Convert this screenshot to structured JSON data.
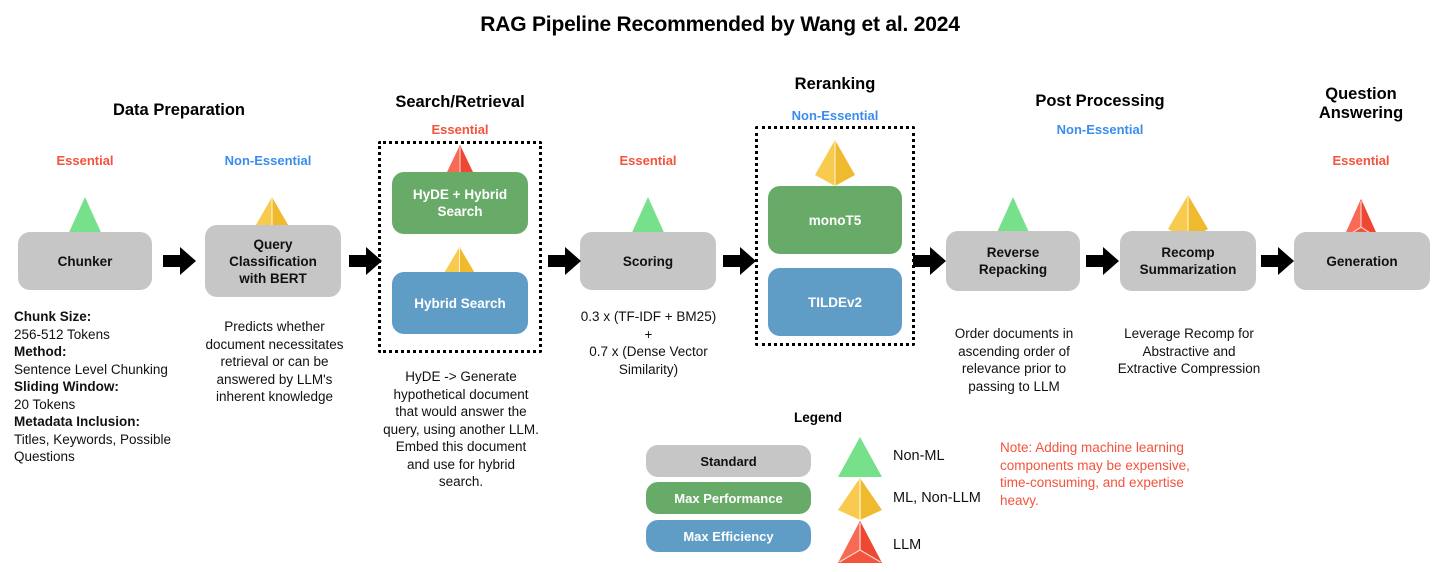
{
  "title": "RAG Pipeline Recommended by Wang et al. 2024",
  "colors": {
    "essential": "#f4533c",
    "non_essential": "#3b8ced",
    "standard_box": "#c6c6c6",
    "max_performance_box": "#68ab68",
    "max_efficiency_box": "#5f9dc7",
    "non_ml_triangle": "#77e08b",
    "ml_non_llm_triangle": "#f5c13b",
    "llm_triangle": "#f4533c",
    "arrow": "#000000",
    "note_text": "#f4533c"
  },
  "stages": [
    {
      "id": "data-preparation",
      "title": "Data Preparation",
      "nodes": [
        {
          "id": "chunker",
          "label": "Chunker",
          "style": "standard",
          "marker": "non-ml",
          "essentiality": "Essential",
          "essentiality_kind": "essential"
        },
        {
          "id": "query-classification",
          "label": "Query Classification with BERT",
          "style": "standard",
          "marker": "ml-non-llm",
          "essentiality": "Non-Essential",
          "essentiality_kind": "non-essential"
        }
      ]
    },
    {
      "id": "search-retrieval",
      "title": "Search/Retrieval",
      "essentiality": "Essential",
      "essentiality_kind": "essential",
      "group": [
        {
          "id": "hyde-hybrid-search",
          "label": "HyDE + Hybrid Search",
          "style": "max-performance",
          "marker": "llm"
        },
        {
          "id": "hybrid-search",
          "label": "Hybrid Search",
          "style": "max-efficiency",
          "marker": "ml-non-llm"
        }
      ]
    },
    {
      "id": "scoring-stage",
      "nodes": [
        {
          "id": "scoring",
          "label": "Scoring",
          "style": "standard",
          "marker": "non-ml",
          "essentiality": "Essential",
          "essentiality_kind": "essential"
        }
      ]
    },
    {
      "id": "reranking",
      "title": "Reranking",
      "essentiality": "Non-Essential",
      "essentiality_kind": "non-essential",
      "group": [
        {
          "id": "monot5",
          "label": "monoT5",
          "style": "max-performance",
          "marker": "ml-non-llm"
        },
        {
          "id": "tildev2",
          "label": "TILDEv2",
          "style": "max-efficiency",
          "marker": "none"
        }
      ]
    },
    {
      "id": "post-processing",
      "title": "Post Processing",
      "essentiality": "Non-Essential",
      "essentiality_kind": "non-essential",
      "nodes": [
        {
          "id": "reverse-repacking",
          "label": "Reverse Repacking",
          "style": "standard",
          "marker": "non-ml"
        },
        {
          "id": "recomp-summarization",
          "label": "Recomp Summarization",
          "style": "standard",
          "marker": "ml-non-llm"
        }
      ]
    },
    {
      "id": "question-answering",
      "title": "Question Answering",
      "essentiality": "Essential",
      "essentiality_kind": "essential",
      "nodes": [
        {
          "id": "generation",
          "label": "Generation",
          "style": "standard",
          "marker": "llm"
        }
      ]
    }
  ],
  "node_labels": {
    "chunker": "Chunker",
    "query_classification_line1": "Query",
    "query_classification_line2": "Classification",
    "query_classification_line3": "with BERT",
    "hyde_hybrid_line1": "HyDE + Hybrid",
    "hyde_hybrid_line2": "Search",
    "hybrid_search": "Hybrid Search",
    "scoring": "Scoring",
    "monot5": "monoT5",
    "tildev2": "TILDEv2",
    "reverse_repacking_line1": "Reverse",
    "reverse_repacking_line2": "Repacking",
    "recomp_line1": "Recomp",
    "recomp_line2": "Summarization",
    "generation": "Generation"
  },
  "stage_titles": {
    "data_preparation": "Data Preparation",
    "search_retrieval": "Search/Retrieval",
    "reranking": "Reranking",
    "post_processing": "Post Processing",
    "question_answering_line1": "Question",
    "question_answering_line2": "Answering"
  },
  "essentiality_labels": {
    "chunker": "Essential",
    "query_classification": "Non-Essential",
    "search_retrieval": "Essential",
    "scoring": "Essential",
    "reranking": "Non-Essential",
    "post_processing": "Non-Essential",
    "question_answering": "Essential"
  },
  "captions": {
    "chunker_details": [
      {
        "label": "Chunk Size:",
        "value": "256-512 Tokens"
      },
      {
        "label": "Method:",
        "value": "Sentence Level Chunking"
      },
      {
        "label": "Sliding Window:",
        "value": "20 Tokens"
      },
      {
        "label": "Metadata Inclusion:",
        "value": "Titles, Keywords, Possible Questions"
      }
    ],
    "query_classification": "Predicts whether document necessitates retrieval or can be answered by LLM's inherent knowledge",
    "search_retrieval": "HyDE -> Generate hypothetical document that would answer the query, using another LLM. Embed this document and use for hybrid search.",
    "scoring_line1": "0.3 x (TF-IDF + BM25)",
    "scoring_line2": "+",
    "scoring_line3": "0.7 x (Dense Vector",
    "scoring_line4": "Similarity)",
    "reverse_repacking": "Order documents in ascending order of relevance prior to passing to LLM",
    "recomp_summarization": "Leverage Recomp for Abstractive and Extractive Compression"
  },
  "legend": {
    "title": "Legend",
    "box_items": [
      {
        "label": "Standard",
        "style": "standard"
      },
      {
        "label": "Max Performance",
        "style": "max-performance"
      },
      {
        "label": "Max Efficiency",
        "style": "max-efficiency"
      }
    ],
    "marker_items": [
      {
        "label": "Non-ML",
        "marker": "non-ml"
      },
      {
        "label": "ML, Non-LLM",
        "marker": "ml-non-llm"
      },
      {
        "label": "LLM",
        "marker": "llm"
      }
    ],
    "note": "Note: Adding machine learning components may be expensive, time-consuming, and expertise heavy."
  }
}
